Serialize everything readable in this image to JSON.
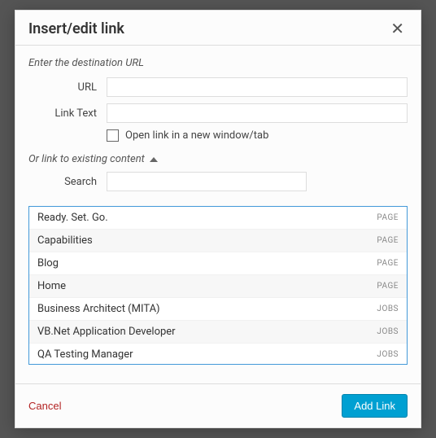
{
  "modal": {
    "title": "Insert/edit link",
    "intro": "Enter the destination URL",
    "url_label": "URL",
    "url_value": "",
    "linktext_label": "Link Text",
    "linktext_value": "",
    "newtab_label": "Open link in a new window/tab",
    "toggle_label": "Or link to existing content",
    "search_label": "Search",
    "search_value": "",
    "cancel_label": "Cancel",
    "submit_label": "Add Link"
  },
  "results": [
    {
      "title": "Ready. Set. Go.",
      "type": "PAGE"
    },
    {
      "title": "Capabilities",
      "type": "PAGE"
    },
    {
      "title": "Blog",
      "type": "PAGE"
    },
    {
      "title": "Home",
      "type": "PAGE"
    },
    {
      "title": "Business Architect (MITA)",
      "type": "JOBS"
    },
    {
      "title": "VB.Net Application Developer",
      "type": "JOBS"
    },
    {
      "title": "QA Testing Manager",
      "type": "JOBS"
    }
  ]
}
